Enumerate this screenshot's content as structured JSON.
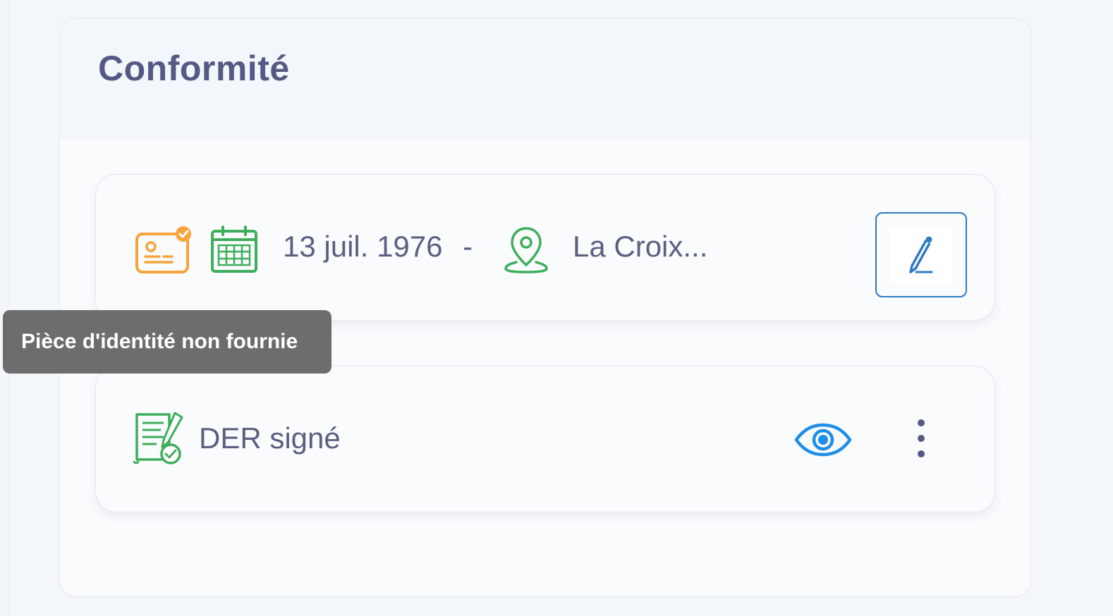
{
  "section": {
    "title": "Conformité"
  },
  "identity_row": {
    "birth_date": "13 juil. 1976",
    "separator": "-",
    "birth_place": "La Croix...",
    "icons": {
      "id_card": "id-card-icon",
      "calendar": "calendar-icon",
      "location": "location-pin-icon",
      "edit": "pencil-icon"
    }
  },
  "tooltip": {
    "text": "Pièce d'identité non fournie"
  },
  "document_row": {
    "label": "DER signé",
    "icons": {
      "document": "signed-document-icon",
      "view": "eye-icon",
      "more": "more-vertical-icon"
    }
  },
  "colors": {
    "title": "#545a85",
    "text": "#5a6080",
    "id_card_orange": "#f7a43a",
    "green": "#3fae5b",
    "blue_accent": "#2f79c6",
    "tooltip_bg": "#6d6d6d"
  }
}
